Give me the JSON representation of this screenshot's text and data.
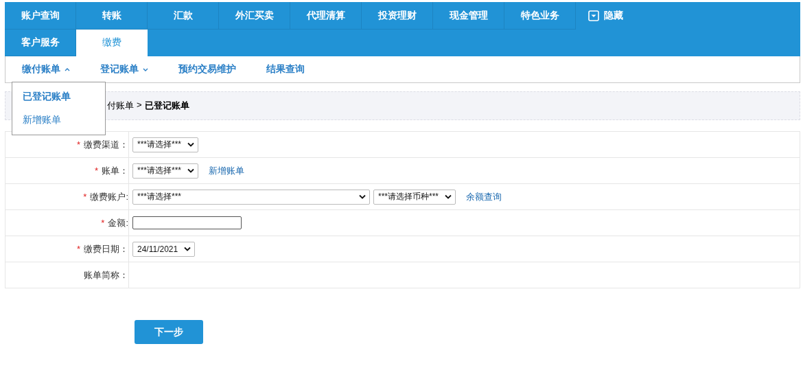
{
  "tab_rows": [
    [
      {
        "label": "账户查询",
        "selected": false
      },
      {
        "label": "转账",
        "selected": false
      },
      {
        "label": "汇款",
        "selected": false
      },
      {
        "label": "外汇买卖",
        "selected": false
      },
      {
        "label": "代理清算",
        "selected": false
      },
      {
        "label": "投资理财",
        "selected": false
      },
      {
        "label": "现金管理",
        "selected": false
      },
      {
        "label": "特色业务",
        "selected": false
      }
    ],
    [
      {
        "label": "客户服务",
        "selected": false
      },
      {
        "label": "缴费",
        "selected": true
      }
    ]
  ],
  "hide_button": {
    "label": "隐藏"
  },
  "sub_menu": [
    {
      "label": "缴付账单",
      "expanded": true
    },
    {
      "label": "登记账单",
      "expanded": false
    },
    {
      "label": "预约交易维护"
    },
    {
      "label": "结果查询"
    }
  ],
  "dropdown": [
    {
      "label": "已登记账单",
      "selected": true
    },
    {
      "label": "新增账单",
      "selected": false
    }
  ],
  "breadcrumb": {
    "parent": "付账单",
    "separator": ">",
    "current": "已登记账单"
  },
  "form_rows": [
    {
      "required_mark": "*",
      "label": "缴费渠道：",
      "controls": [
        {
          "kind": "select",
          "value": "***请选择***"
        }
      ]
    },
    {
      "required_mark": "*",
      "label": "账单：",
      "controls": [
        {
          "kind": "select",
          "value": "***请选择***"
        },
        {
          "kind": "link",
          "text": "新增账单"
        }
      ]
    },
    {
      "required_mark": "*",
      "label": "缴费账户:",
      "controls": [
        {
          "kind": "wideselect",
          "value": "***请选择***"
        },
        {
          "kind": "select",
          "value": "***请选择币种***"
        },
        {
          "kind": "link",
          "text": "余额查询"
        }
      ]
    },
    {
      "required_mark": "*",
      "label": "金额:",
      "controls": [
        {
          "kind": "input"
        }
      ]
    },
    {
      "required_mark": "*",
      "label": "缴费日期：",
      "controls": [
        {
          "kind": "select",
          "value": "24/11/2021"
        }
      ]
    },
    {
      "label": "账单简称：",
      "controls": []
    }
  ],
  "next_button": {
    "label": "下一步"
  }
}
